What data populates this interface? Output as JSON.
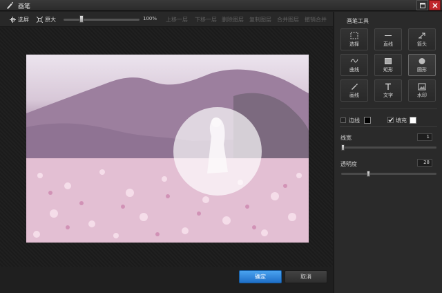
{
  "window": {
    "title": "画笔"
  },
  "toolbar": {
    "select_label": "选屏",
    "original_label": "原大",
    "zoom_percent": "100%",
    "zoom_level": 0.22,
    "layer_up": "上移一层",
    "layer_down": "下移一层",
    "delete_layer": "删除图层",
    "copy_layer": "复制图层",
    "merge_layer": "合并图层",
    "undo_merge": "撤销合并"
  },
  "panel": {
    "title": "画笔工具",
    "tools": [
      {
        "label": "选择",
        "icon": "select-icon",
        "selected": false
      },
      {
        "label": "直线",
        "icon": "line-icon",
        "selected": false
      },
      {
        "label": "箭头",
        "icon": "arrow-icon",
        "selected": false
      },
      {
        "label": "曲线",
        "icon": "curve-icon",
        "selected": false
      },
      {
        "label": "矩形",
        "icon": "rectangle-icon",
        "selected": false
      },
      {
        "label": "圆形",
        "icon": "circle-icon",
        "selected": true
      },
      {
        "label": "画线",
        "icon": "brush-icon",
        "selected": false
      },
      {
        "label": "文字",
        "icon": "text-icon",
        "selected": false
      },
      {
        "label": "水印",
        "icon": "watermark-icon",
        "selected": false
      }
    ],
    "border_label": "边线",
    "border_checked": false,
    "border_color": "#000000",
    "fill_label": "填充",
    "fill_checked": true,
    "fill_color": "#ffffff",
    "line_width_label": "线宽",
    "line_width_value": "1",
    "line_width_level": 0.0,
    "opacity_label": "透明度",
    "opacity_value": "28",
    "opacity_level": 0.28
  },
  "buttons": {
    "ok": "确定",
    "cancel": "取消"
  },
  "colors": {
    "accent": "#2f86de",
    "close": "#c0262b"
  }
}
